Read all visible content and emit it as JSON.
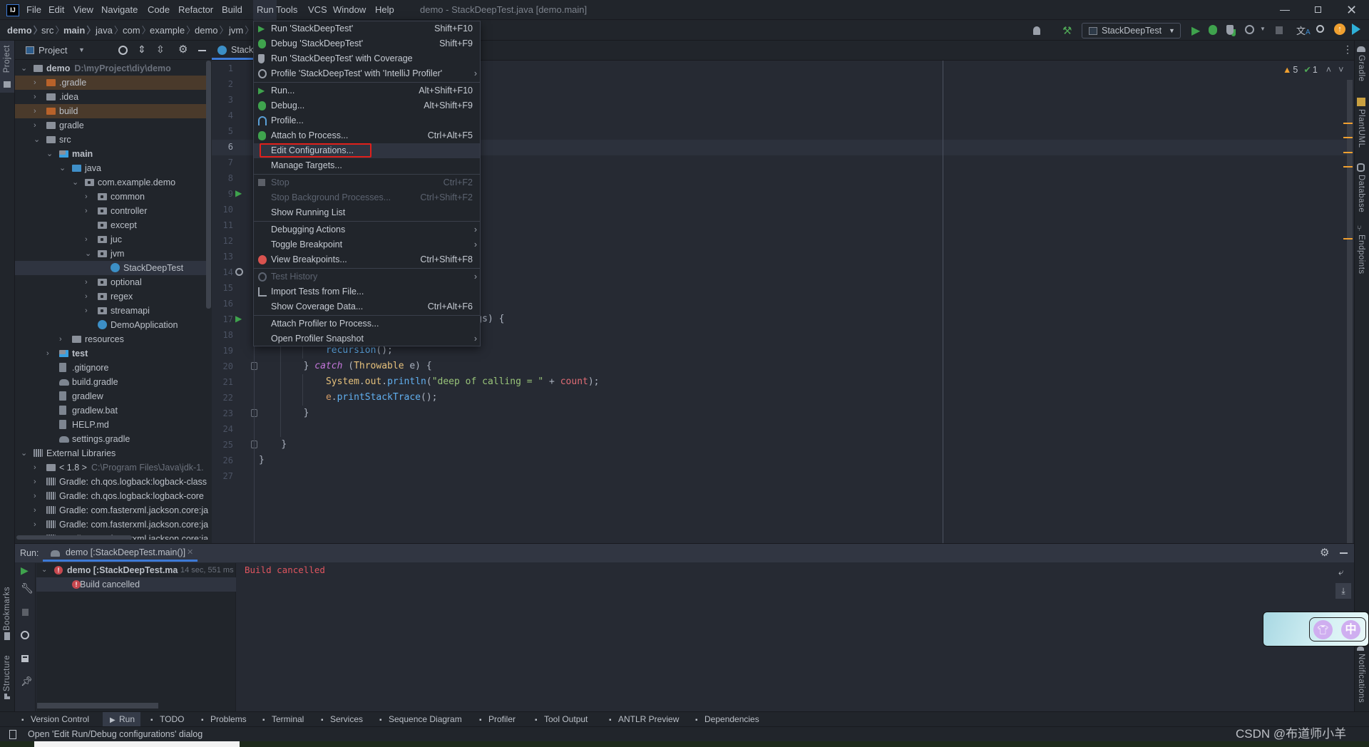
{
  "window": {
    "title": "demo - StackDeepTest.java [demo.main]",
    "logo": "IJ"
  },
  "menubar": {
    "items": [
      "File",
      "Edit",
      "View",
      "Navigate",
      "Code",
      "Refactor",
      "Build",
      "Run",
      "Tools",
      "VCS",
      "Window",
      "Help"
    ],
    "active": "Run"
  },
  "breadcrumb": [
    "demo",
    "src",
    "main",
    "java",
    "com",
    "example",
    "demo",
    "jvm"
  ],
  "toolbar": {
    "run_config": "StackDeepTest",
    "icons": [
      "user-icon",
      "hammer-icon",
      "run-icon",
      "debug-icon",
      "coverage-icon",
      "profile-icon",
      "stop-icon",
      "translate-icon",
      "search-icon",
      "update-icon",
      "plugin-icon"
    ]
  },
  "left_stripe": {
    "project": "Project",
    "bookmarks": "Bookmarks",
    "structure": "Structure"
  },
  "right_stripe": [
    "Gradle",
    "PlantUML",
    "Database",
    "Endpoints",
    "Notifications"
  ],
  "project_panel": {
    "title": "Project",
    "tree": [
      {
        "label": "demo",
        "sub": "D:\\myProject\\diy\\demo",
        "level": 0,
        "arrow": "open",
        "icon": "folder",
        "bold": true
      },
      {
        "label": ".gradle",
        "level": 1,
        "arrow": "closed",
        "icon": "folder-orange",
        "excluded": true
      },
      {
        "label": ".idea",
        "level": 1,
        "arrow": "closed",
        "icon": "folder"
      },
      {
        "label": "build",
        "level": 1,
        "arrow": "closed",
        "icon": "folder-orange",
        "excluded": true
      },
      {
        "label": "gradle",
        "level": 1,
        "arrow": "closed",
        "icon": "folder"
      },
      {
        "label": "src",
        "level": 1,
        "arrow": "open",
        "icon": "folder"
      },
      {
        "label": "main",
        "level": 2,
        "arrow": "open",
        "icon": "folder-src",
        "bold": true
      },
      {
        "label": "java",
        "level": 3,
        "arrow": "open",
        "icon": "folder-blue"
      },
      {
        "label": "com.example.demo",
        "level": 4,
        "arrow": "open",
        "icon": "package"
      },
      {
        "label": "common",
        "level": 5,
        "arrow": "closed",
        "icon": "package"
      },
      {
        "label": "controller",
        "level": 5,
        "arrow": "closed",
        "icon": "package"
      },
      {
        "label": "except",
        "level": 5,
        "arrow": "none",
        "icon": "package"
      },
      {
        "label": "juc",
        "level": 5,
        "arrow": "closed",
        "icon": "package"
      },
      {
        "label": "jvm",
        "level": 5,
        "arrow": "open",
        "icon": "package"
      },
      {
        "label": "StackDeepTest",
        "level": 6,
        "arrow": "none",
        "icon": "class",
        "selected": true
      },
      {
        "label": "optional",
        "level": 5,
        "arrow": "closed",
        "icon": "package"
      },
      {
        "label": "regex",
        "level": 5,
        "arrow": "closed",
        "icon": "package"
      },
      {
        "label": "streamapi",
        "level": 5,
        "arrow": "closed",
        "icon": "package"
      },
      {
        "label": "DemoApplication",
        "level": 5,
        "arrow": "none",
        "icon": "class"
      },
      {
        "label": "resources",
        "level": 3,
        "arrow": "closed",
        "icon": "folder"
      },
      {
        "label": "test",
        "level": 2,
        "arrow": "closed",
        "icon": "folder-src",
        "bold": true
      },
      {
        "label": ".gitignore",
        "level": 2,
        "arrow": "none",
        "icon": "file"
      },
      {
        "label": "build.gradle",
        "level": 2,
        "arrow": "none",
        "icon": "gradle"
      },
      {
        "label": "gradlew",
        "level": 2,
        "arrow": "none",
        "icon": "file"
      },
      {
        "label": "gradlew.bat",
        "level": 2,
        "arrow": "none",
        "icon": "file"
      },
      {
        "label": "HELP.md",
        "level": 2,
        "arrow": "none",
        "icon": "file"
      },
      {
        "label": "settings.gradle",
        "level": 2,
        "arrow": "none",
        "icon": "gradle"
      },
      {
        "label": "External Libraries",
        "level": 0,
        "arrow": "open",
        "icon": "library"
      },
      {
        "label": "< 1.8 >",
        "sub": "C:\\Program Files\\Java\\jdk-1.",
        "level": 1,
        "arrow": "closed",
        "icon": "folder"
      },
      {
        "label": "Gradle: ch.qos.logback:logback-class",
        "level": 1,
        "arrow": "closed",
        "icon": "library"
      },
      {
        "label": "Gradle: ch.qos.logback:logback-core",
        "level": 1,
        "arrow": "closed",
        "icon": "library"
      },
      {
        "label": "Gradle: com.fasterxml.jackson.core:ja",
        "level": 1,
        "arrow": "closed",
        "icon": "library"
      },
      {
        "label": "Gradle: com.fasterxml.jackson.core:ja",
        "level": 1,
        "arrow": "closed",
        "icon": "library"
      },
      {
        "label": "Gradle: com.fasterxml.jackson.core:ja",
        "level": 1,
        "arrow": "closed",
        "icon": "library"
      }
    ]
  },
  "editor": {
    "tab": "Stack",
    "inspections": {
      "warnings": "5",
      "weak_warnings": "1"
    },
    "current_line": 6,
    "line_count": 27,
    "gutter_run_lines": [
      9,
      17
    ],
    "gutter_recursion_lines": [
      14
    ],
    "lines": [
      {
        "n": 17,
        "col": 39,
        "tokens": [
          {
            "t": "gs) {",
            "k": "p"
          }
        ]
      },
      {
        "n": 19,
        "col": 12,
        "tokens": [
          {
            "t": "recursion",
            "k": "fn"
          },
          {
            "t": "();",
            "k": "p"
          }
        ]
      },
      {
        "n": 20,
        "col": 8,
        "tokens": [
          {
            "t": "} ",
            "k": "p"
          },
          {
            "t": "catch",
            "k": "kw"
          },
          {
            "t": " (",
            "k": "p"
          },
          {
            "t": "Throwable",
            "k": "type"
          },
          {
            "t": " e) {",
            "k": "p"
          }
        ]
      },
      {
        "n": 21,
        "col": 12,
        "tokens": [
          {
            "t": "System",
            "k": "type"
          },
          {
            "t": ".",
            "k": "p"
          },
          {
            "t": "out",
            "k": "type"
          },
          {
            "t": ".",
            "k": "p"
          },
          {
            "t": "println",
            "k": "fn"
          },
          {
            "t": "(",
            "k": "p"
          },
          {
            "t": "\"deep of calling = \"",
            "k": "str"
          },
          {
            "t": " + ",
            "k": "p"
          },
          {
            "t": "count",
            "k": "fld"
          },
          {
            "t": ");",
            "k": "p"
          }
        ]
      },
      {
        "n": 22,
        "col": 12,
        "tokens": [
          {
            "t": "e",
            "k": "var"
          },
          {
            "t": ".",
            "k": "p"
          },
          {
            "t": "printStackTrace",
            "k": "fn"
          },
          {
            "t": "();",
            "k": "p"
          }
        ]
      },
      {
        "n": 23,
        "col": 8,
        "tokens": [
          {
            "t": "}",
            "k": "p"
          }
        ]
      },
      {
        "n": 25,
        "col": 4,
        "tokens": [
          {
            "t": "}",
            "k": "p"
          }
        ]
      },
      {
        "n": 26,
        "col": 0,
        "tokens": [
          {
            "t": "}",
            "k": "p"
          }
        ]
      }
    ]
  },
  "run_menu": {
    "groups": [
      [
        {
          "label": "Run 'StackDeepTest'",
          "shortcut": "Shift+F10",
          "icon": "run-icon"
        },
        {
          "label": "Debug 'StackDeepTest'",
          "shortcut": "Shift+F9",
          "icon": "debug-icon"
        },
        {
          "label": "Run 'StackDeepTest' with Coverage",
          "icon": "coverage-icon"
        },
        {
          "label": "Profile 'StackDeepTest' with 'IntelliJ Profiler'",
          "icon": "profiler-icon",
          "submenu": true
        }
      ],
      [
        {
          "label": "Run...",
          "shortcut": "Alt+Shift+F10",
          "icon": "run-icon"
        },
        {
          "label": "Debug...",
          "shortcut": "Alt+Shift+F9",
          "icon": "debug-icon"
        },
        {
          "label": "Profile...",
          "icon": "profile-gauge-icon"
        },
        {
          "label": "Attach to Process...",
          "shortcut": "Ctrl+Alt+F5",
          "icon": "attach-icon"
        },
        {
          "label": "Edit Configurations...",
          "highlighted": true
        },
        {
          "label": "Manage Targets..."
        }
      ],
      [
        {
          "label": "Stop",
          "shortcut": "Ctrl+F2",
          "icon": "stop-icon",
          "disabled": true
        },
        {
          "label": "Stop Background Processes...",
          "shortcut": "Ctrl+Shift+F2",
          "disabled": true
        },
        {
          "label": "Show Running List"
        }
      ],
      [
        {
          "label": "Debugging Actions",
          "submenu": true
        },
        {
          "label": "Toggle Breakpoint",
          "submenu": true
        },
        {
          "label": "View Breakpoints...",
          "shortcut": "Ctrl+Shift+F8",
          "icon": "breakpoints-icon"
        }
      ],
      [
        {
          "label": "Test History",
          "icon": "test-history-icon",
          "submenu": true,
          "disabled": true
        },
        {
          "label": "Import Tests from File...",
          "icon": "import-tests-icon"
        },
        {
          "label": "Show Coverage Data...",
          "shortcut": "Ctrl+Alt+F6"
        }
      ],
      [
        {
          "label": "Attach Profiler to Process..."
        },
        {
          "label": "Open Profiler Snapshot",
          "submenu": true
        }
      ]
    ]
  },
  "run_panel": {
    "label": "Run:",
    "tab": "demo [:StackDeepTest.main()]",
    "tree": {
      "root": "demo [:StackDeepTest.ma",
      "duration": "14 sec, 551 ms",
      "child": "Build cancelled"
    },
    "console": "Build cancelled"
  },
  "bottom_toolbar": [
    {
      "label": "Version Control",
      "icon": "version-control-icon"
    },
    {
      "label": "Run",
      "icon": "run-icon",
      "active": true
    },
    {
      "label": "TODO",
      "icon": "todo-icon"
    },
    {
      "label": "Problems",
      "icon": "problems-icon"
    },
    {
      "label": "Terminal",
      "icon": "terminal-icon"
    },
    {
      "label": "Services",
      "icon": "services-icon"
    },
    {
      "label": "Sequence Diagram",
      "icon": "sequence-diagram-icon"
    },
    {
      "label": "Profiler",
      "icon": "profiler-icon"
    },
    {
      "label": "Tool Output",
      "icon": "tool-output-icon"
    },
    {
      "label": "ANTLR Preview",
      "icon": "antlr-icon"
    },
    {
      "label": "Dependencies",
      "icon": "dependencies-icon"
    }
  ],
  "status": {
    "message": "Open 'Edit Run/Debug configurations' dialog",
    "watermark": "CSDN @布道师小羊"
  },
  "colors": {
    "accent": "#3d7ad6",
    "error": "#e0555f",
    "run_green": "#3fa34d",
    "highlight_box": "#e0201b"
  }
}
